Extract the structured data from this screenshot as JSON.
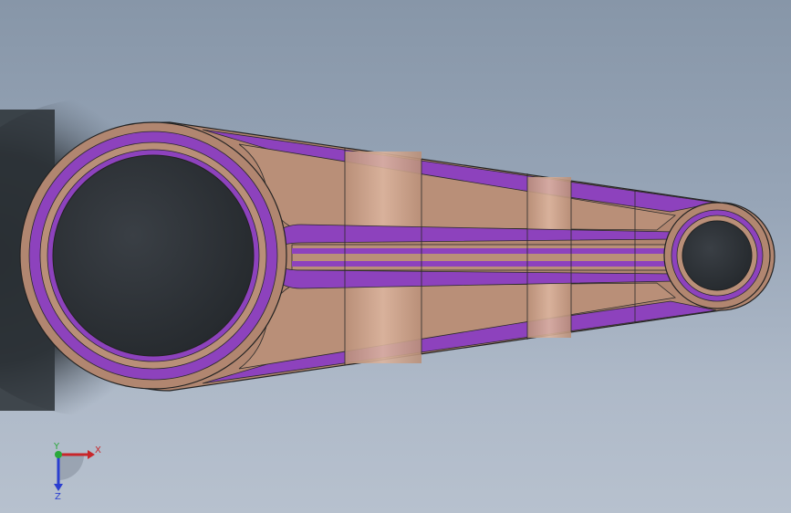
{
  "viewport": {
    "background_top": "#8796a8",
    "background_bottom": "#b7c1ce",
    "model": {
      "name": "connecting rod",
      "body_color": "#b98f78",
      "highlight_color": "#d6ad97",
      "fillet_color": "#8a3fb8",
      "fillet_highlight": "#b46ee0",
      "edge_color": "#2a2a2a",
      "hole_color": "#2c3034"
    }
  },
  "triad": {
    "x_label": "X",
    "y_label": "Y",
    "z_label": "Z",
    "x_color": "#c8262a",
    "y_color": "#2aa83a",
    "z_color": "#2a3ed0"
  }
}
